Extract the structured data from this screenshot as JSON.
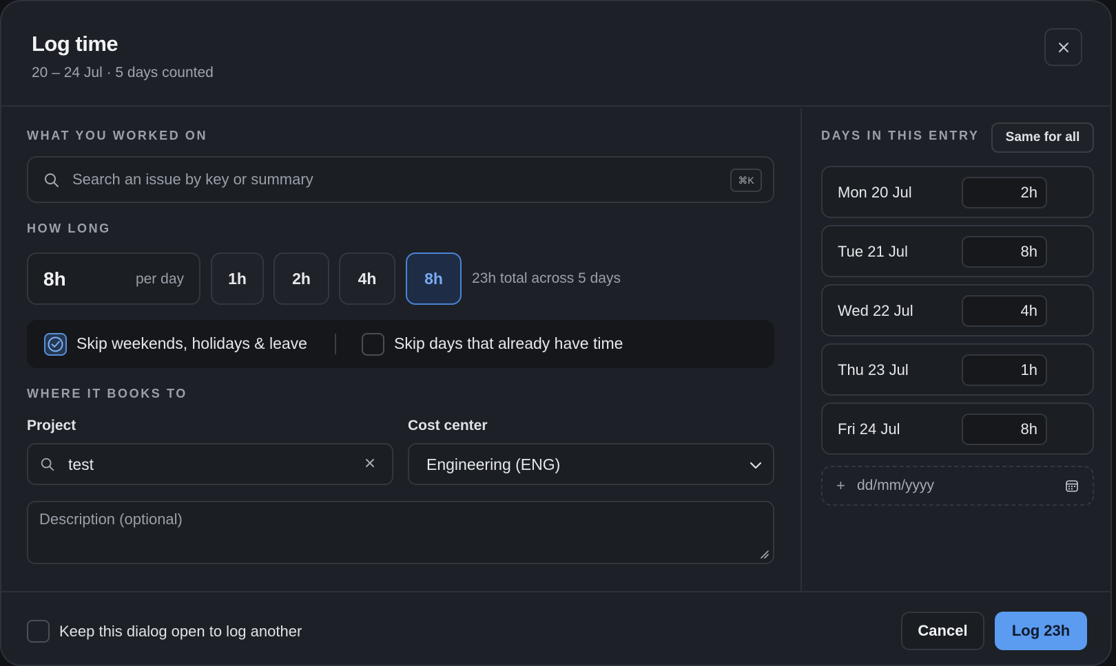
{
  "header": {
    "title": "Log time",
    "subtitle": "20 – 24 Jul · 5 days counted",
    "close_icon": "close-icon"
  },
  "work": {
    "section_label": "WHAT YOU WORKED ON",
    "search_placeholder": "Search an issue by key or summary",
    "search_value": "",
    "shortcut": "⌘K"
  },
  "duration": {
    "section_label": "HOW LONG",
    "per_day_value": "8h",
    "per_day_unit": "per day",
    "presets": [
      "1h",
      "2h",
      "4h",
      "8h"
    ],
    "selected_preset": "8h",
    "total_text": "23h total across 5 days"
  },
  "options": {
    "skip_weekends_label": "Skip weekends, holidays & leave",
    "skip_weekends_checked": true,
    "skip_existing_label": "Skip days that already have time",
    "skip_existing_checked": false
  },
  "booking": {
    "section_label": "WHERE IT BOOKS TO",
    "project_label": "Project",
    "project_value": "test",
    "cost_center_label": "Cost center",
    "cost_center_value": "Engineering (ENG)",
    "description_placeholder": "Description (optional)"
  },
  "days": {
    "section_label": "DAYS IN THIS ENTRY",
    "same_for_all_label": "Same for all",
    "items": [
      {
        "day": "Mon 20 Jul",
        "hours": "2h"
      },
      {
        "day": "Tue 21 Jul",
        "hours": "8h"
      },
      {
        "day": "Wed 22 Jul",
        "hours": "4h"
      },
      {
        "day": "Thu 23 Jul",
        "hours": "1h"
      },
      {
        "day": "Fri 24 Jul",
        "hours": "8h"
      }
    ],
    "add_plus": "+",
    "add_date_placeholder": "dd/mm/yyyy"
  },
  "footer": {
    "keep_open_label": "Keep this dialog open to log another",
    "keep_open_checked": false,
    "cancel_label": "Cancel",
    "submit_label": "Log 23h"
  },
  "colors": {
    "accent": "#5b9bf0",
    "background": "#1d2026"
  }
}
